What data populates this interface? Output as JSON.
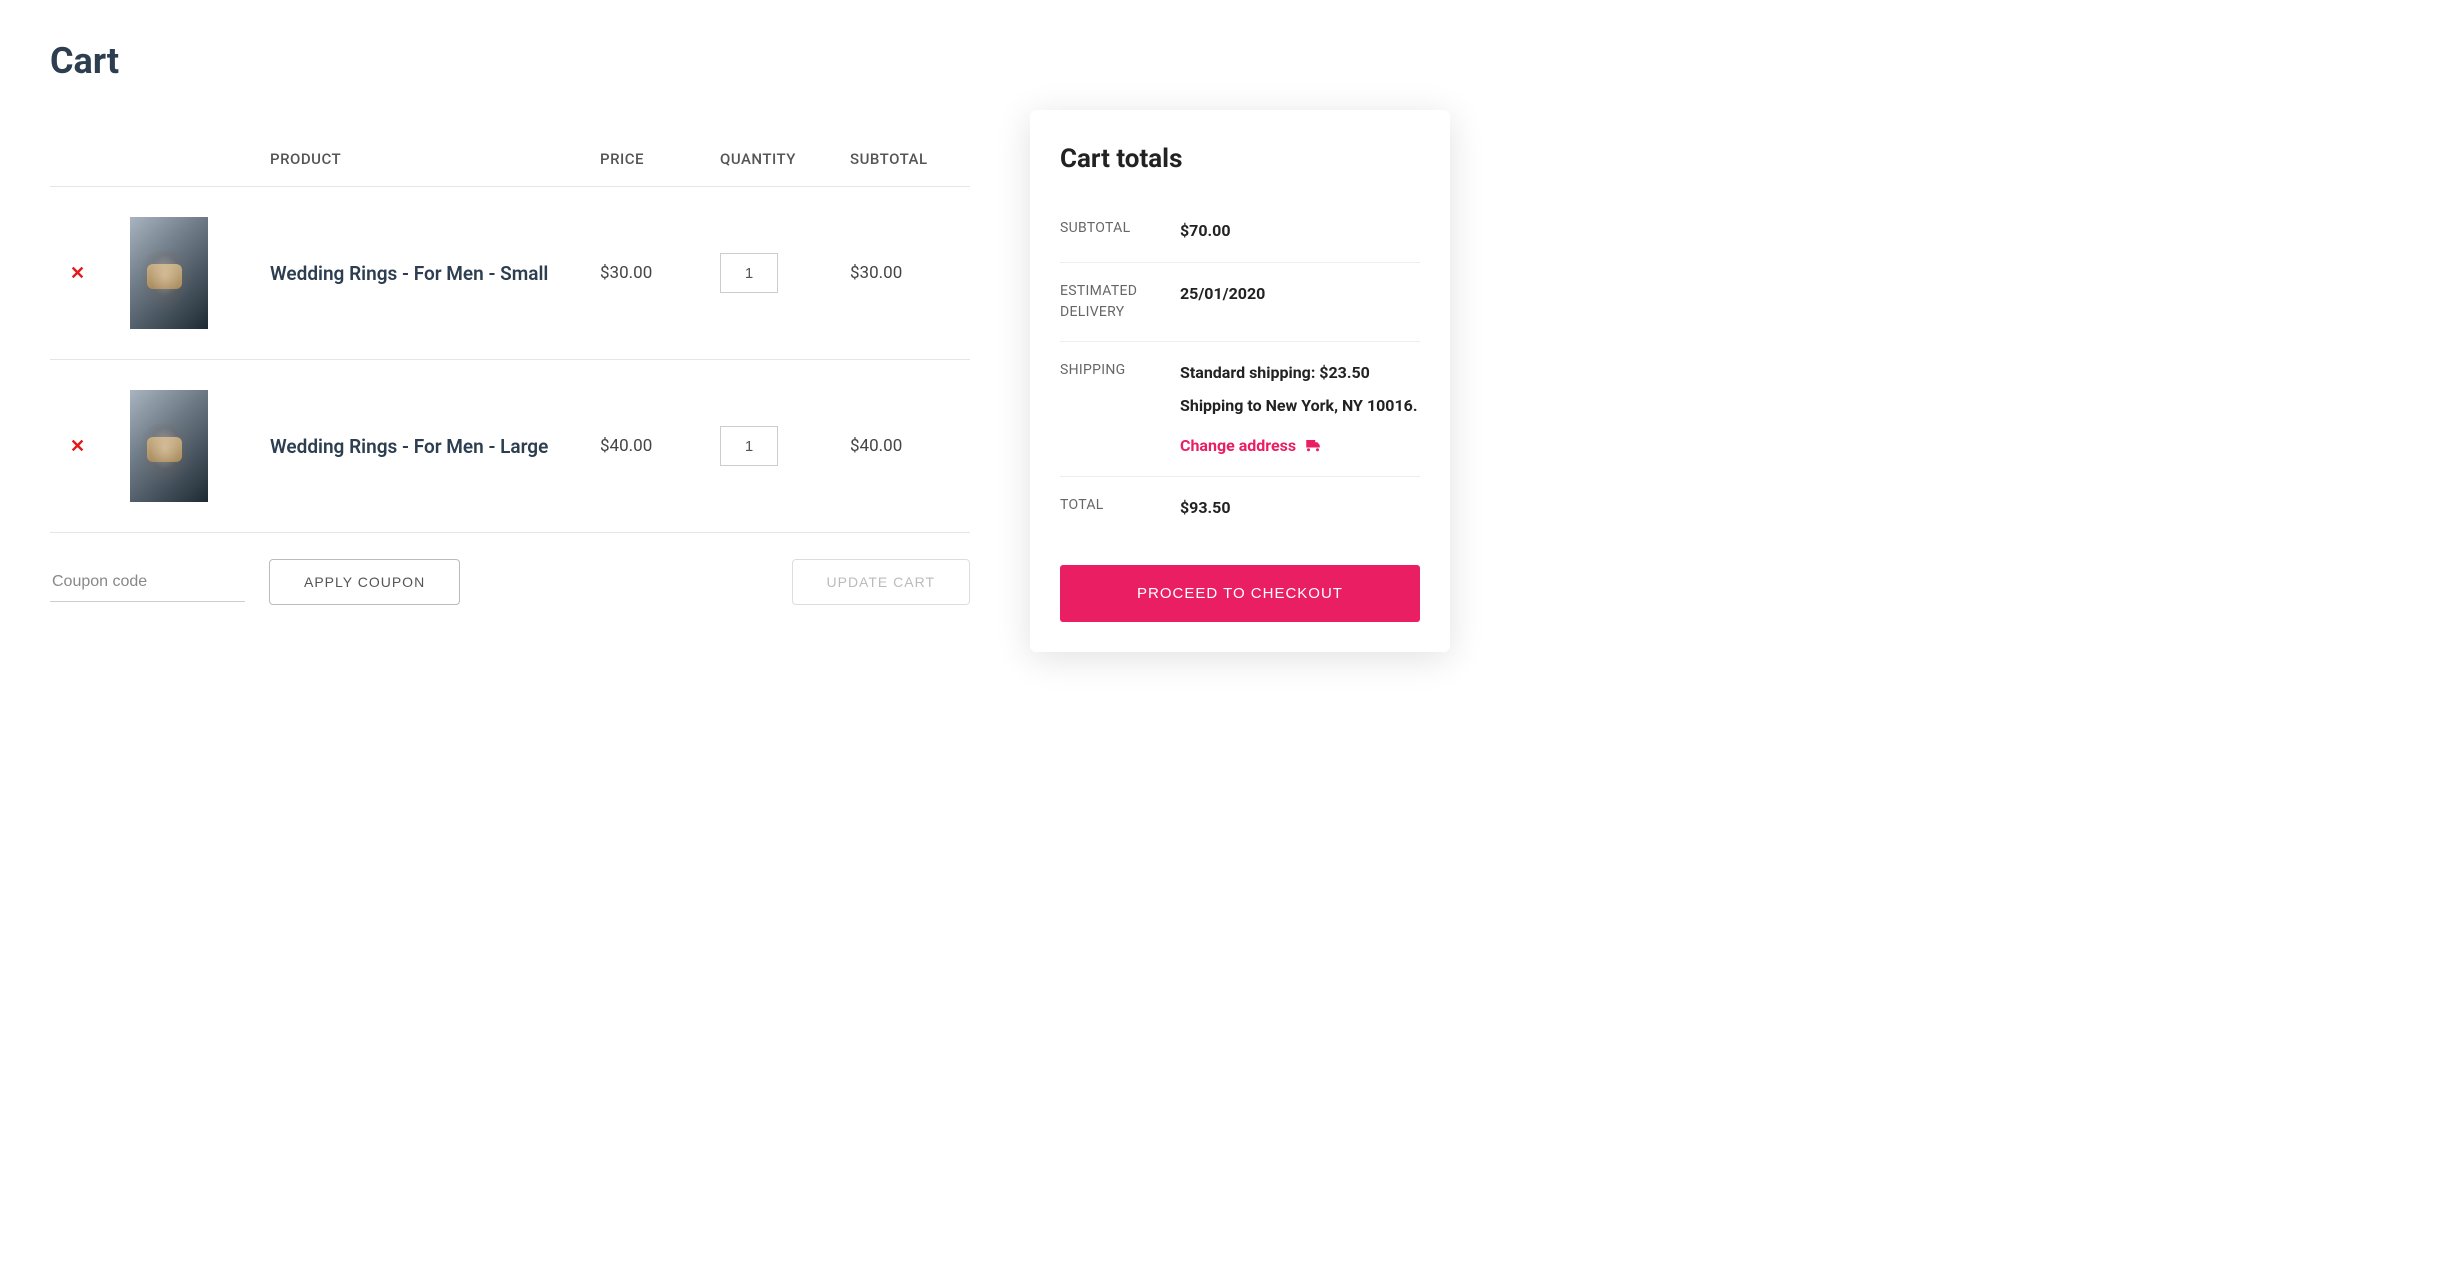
{
  "page_title": "Cart",
  "table": {
    "headers": {
      "product": "PRODUCT",
      "price": "PRICE",
      "quantity": "QUANTITY",
      "subtotal": "SUBTOTAL"
    },
    "rows": [
      {
        "name": "Wedding Rings - For Men - Small",
        "price": "$30.00",
        "quantity": "1",
        "subtotal": "$30.00"
      },
      {
        "name": "Wedding Rings - For Men - Large",
        "price": "$40.00",
        "quantity": "1",
        "subtotal": "$40.00"
      }
    ]
  },
  "coupon": {
    "placeholder": "Coupon code",
    "apply_label": "APPLY COUPON"
  },
  "update_cart_label": "UPDATE CART",
  "totals": {
    "title": "Cart totals",
    "subtotal_label": "SUBTOTAL",
    "subtotal_value": "$70.00",
    "delivery_label": "ESTIMATED DELIVERY",
    "delivery_value": "25/01/2020",
    "shipping_label": "SHIPPING",
    "shipping_method": "Standard shipping: $23.50",
    "shipping_to": "Shipping to New York, NY 10016.",
    "change_address_label": "Change address",
    "total_label": "TOTAL",
    "total_value": "$93.50",
    "checkout_label": "PROCEED TO CHECKOUT"
  }
}
